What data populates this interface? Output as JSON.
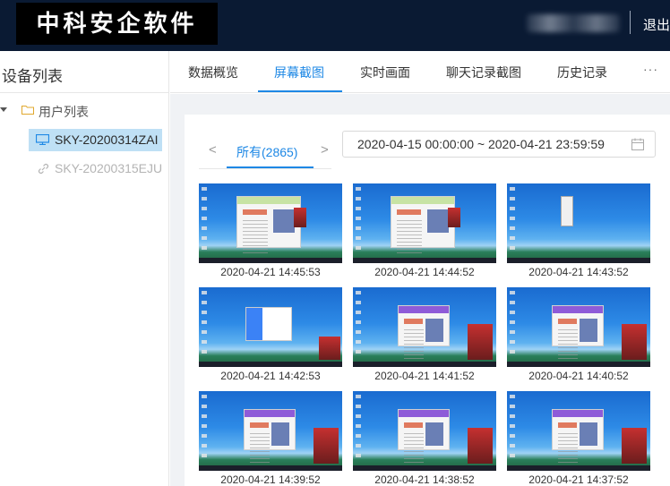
{
  "header": {
    "logo_text": "中科安企软件",
    "logout_label": "退出"
  },
  "sidebar": {
    "title": "设备列表",
    "tree_root_label": "用户列表",
    "devices": [
      {
        "label": "SKY-20200314ZAI",
        "status": "online",
        "selected": true
      },
      {
        "label": "SKY-20200315EJU",
        "status": "offline",
        "selected": false
      }
    ]
  },
  "tabs": [
    {
      "label": "数据概览",
      "active": false
    },
    {
      "label": "屏幕截图",
      "active": true
    },
    {
      "label": "实时画面",
      "active": false
    },
    {
      "label": "聊天记录截图",
      "active": false
    },
    {
      "label": "历史记录",
      "active": false
    }
  ],
  "tabs_more_label": "···",
  "filter": {
    "prev_label": "<",
    "next_label": ">",
    "active_filter_label": "所有(2865)",
    "date_range": "2020-04-15 00:00:00  ~  2020-04-21 23:59:59"
  },
  "screenshots": [
    {
      "timestamp": "2020-04-21 14:45:53",
      "kind": "browser-with-poster"
    },
    {
      "timestamp": "2020-04-21 14:44:52",
      "kind": "browser-with-poster"
    },
    {
      "timestamp": "2020-04-21 14:43:52",
      "kind": "context-menu"
    },
    {
      "timestamp": "2020-04-21 14:42:53",
      "kind": "login-dialog"
    },
    {
      "timestamp": "2020-04-21 14:41:52",
      "kind": "browser-with-poster"
    },
    {
      "timestamp": "2020-04-21 14:40:52",
      "kind": "browser-with-poster"
    },
    {
      "timestamp": "2020-04-21 14:39:52",
      "kind": "browser-with-poster"
    },
    {
      "timestamp": "2020-04-21 14:38:52",
      "kind": "browser-with-poster"
    },
    {
      "timestamp": "2020-04-21 14:37:52",
      "kind": "browser-with-poster"
    }
  ],
  "colors": {
    "accent": "#1e88e5",
    "header_bg": "#0a1a33",
    "selected_item_bg": "#bfe0f5"
  }
}
